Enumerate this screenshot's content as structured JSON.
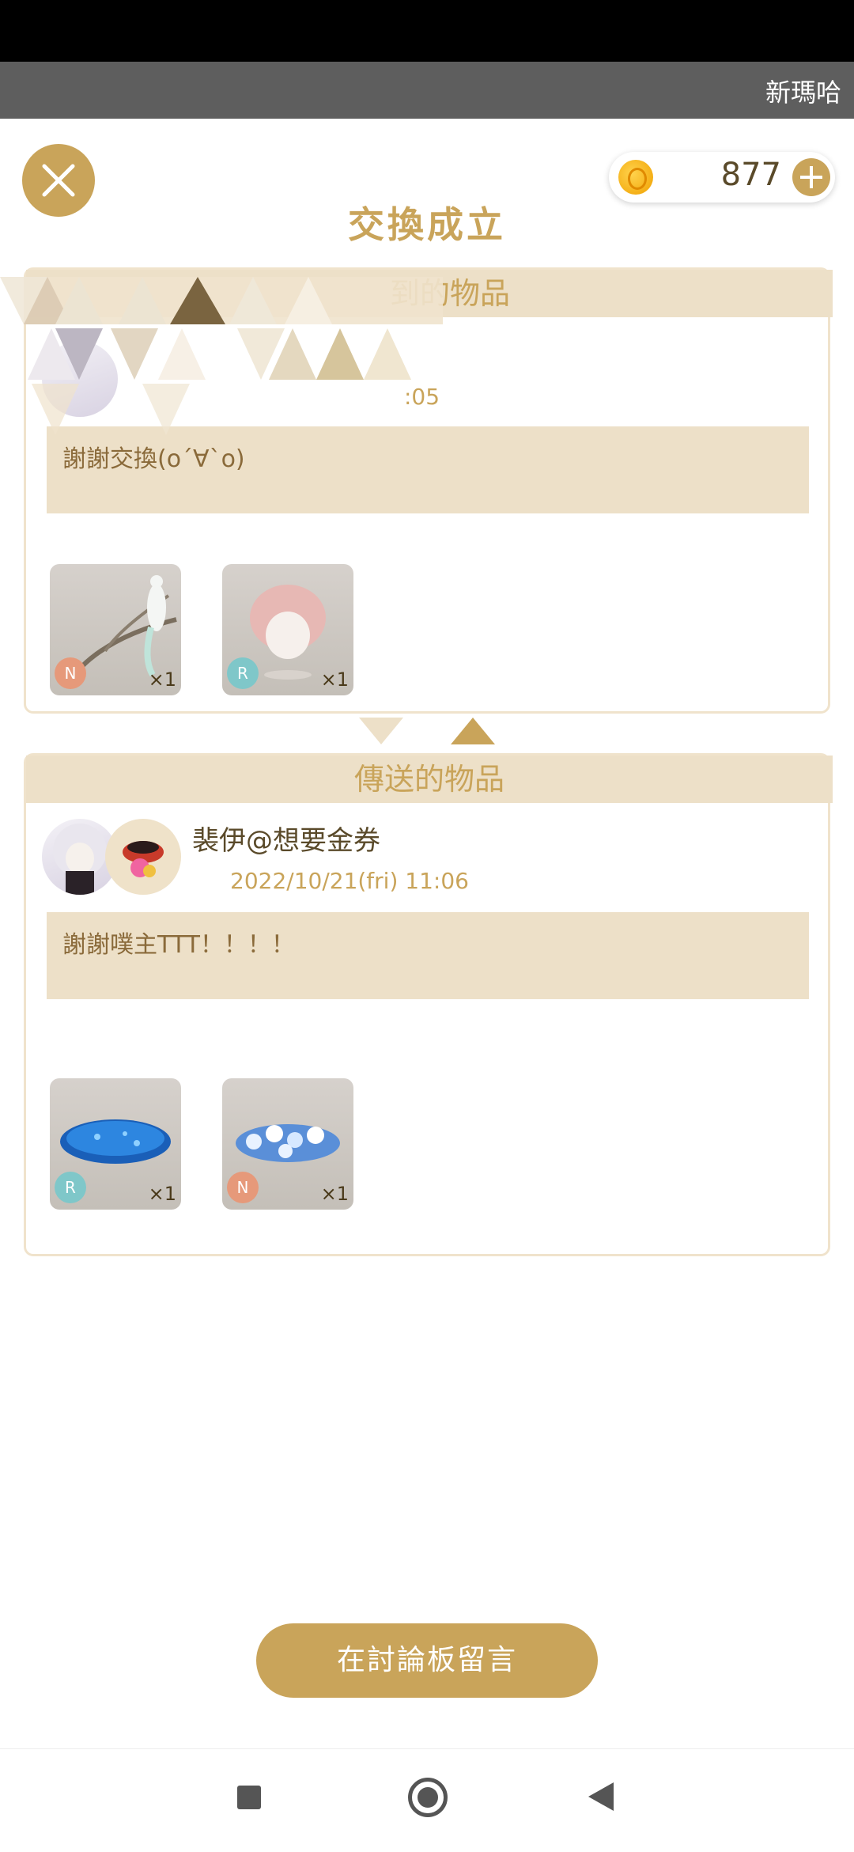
{
  "ticker": {
    "text": "新瑪哈"
  },
  "coins": {
    "count": "877"
  },
  "title": "交換成立",
  "received": {
    "header": "收到的物品",
    "header_visible": "到的物品",
    "timestamp_visible": ":05",
    "message": "謝謝交換(o´∀`o)",
    "items": [
      {
        "name": "white-peacock-branch",
        "rarity": "N",
        "qty": "×1"
      },
      {
        "name": "pink-curly-hair",
        "rarity": "R",
        "qty": "×1"
      }
    ]
  },
  "sent": {
    "header": "傳送的物品",
    "user_name": "裴伊@想要金券",
    "timestamp": "2022/10/21(fri) 11:06",
    "message": "謝謝噗主TTT！！！！",
    "items": [
      {
        "name": "blue-sparkle-rug",
        "rarity": "R",
        "qty": "×1"
      },
      {
        "name": "blue-star-flower-bed",
        "rarity": "N",
        "qty": "×1"
      }
    ]
  },
  "discuss_button": "在討論板留言",
  "colors": {
    "gold": "#c9a45a",
    "beige": "#ede0c8",
    "dark_text": "#5a4a2a"
  }
}
